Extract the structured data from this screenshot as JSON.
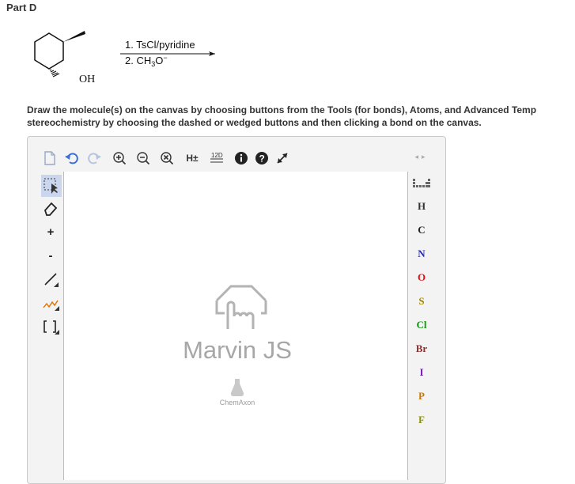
{
  "part_title": "Part D",
  "reaction": {
    "step1": "1. TsCl/pyridine",
    "step2_prefix": "2. CH",
    "step2_sub": "3",
    "step2_suffix": "O",
    "step2_charge": "−",
    "oh_label": "OH"
  },
  "instructions": {
    "line1": "Draw the molecule(s) on the canvas by choosing buttons from the Tools (for bonds), Atoms, and Advanced Temp",
    "line2": "stereochemistry by choosing the dashed or wedged buttons and then clicking a bond on the canvas."
  },
  "toolbar": {
    "h_toggle": "H±",
    "numbering": "12D"
  },
  "left_tools": {
    "plus": "+",
    "minus": "-"
  },
  "atoms": [
    "H",
    "C",
    "N",
    "O",
    "S",
    "Cl",
    "Br",
    "I",
    "P",
    "F"
  ],
  "atom_colors": [
    "#333333",
    "#222222",
    "#2a2ab8",
    "#e01010",
    "#a08a00",
    "#119911",
    "#8b2e2e",
    "#7b18c4",
    "#c87800",
    "#8f8f00"
  ],
  "logo": {
    "title": "Marvin JS",
    "brand": "ChemAxon"
  }
}
